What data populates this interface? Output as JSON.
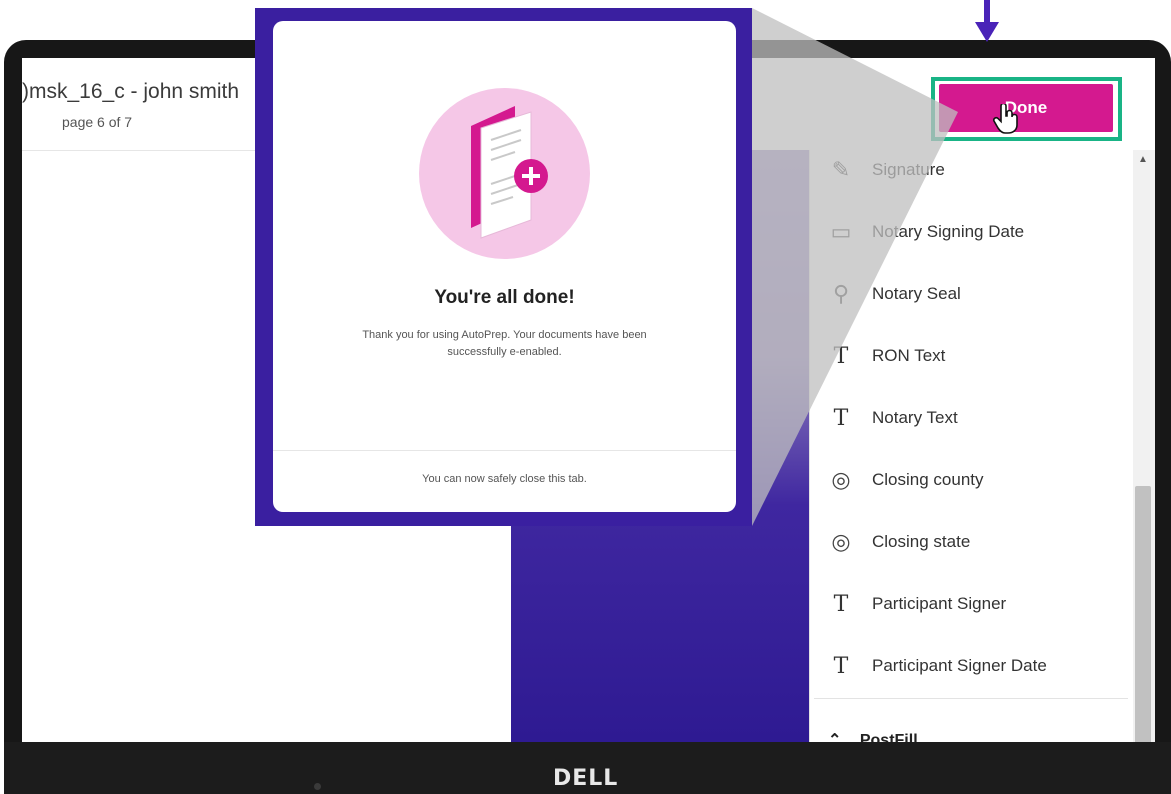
{
  "header": {
    "doc_title": ")msk_16_c - john smith",
    "page_indicator": "page 6 of 7",
    "done_label": "Done"
  },
  "sidebar": {
    "items": [
      {
        "icon": "signature-icon",
        "glyph": "✎",
        "label": "Signature"
      },
      {
        "icon": "calendar-icon",
        "glyph": "▭",
        "label": "Notary Signing Date"
      },
      {
        "icon": "stamp-icon",
        "glyph": "⚲",
        "label": "Notary Seal"
      },
      {
        "icon": "text-icon",
        "glyph": "T",
        "label": "RON Text"
      },
      {
        "icon": "text-icon",
        "glyph": "T",
        "label": "Notary Text"
      },
      {
        "icon": "location-icon",
        "glyph": "◎",
        "label": "Closing county"
      },
      {
        "icon": "location-icon",
        "glyph": "◎",
        "label": "Closing state"
      },
      {
        "icon": "text-icon",
        "glyph": "T",
        "label": "Participant Signer"
      },
      {
        "icon": "text-icon",
        "glyph": "T",
        "label": "Participant Signer Date"
      }
    ],
    "section_label": "PostFill",
    "section_glyph": "⌃"
  },
  "modal": {
    "title": "You're all done!",
    "body": "Thank you for using AutoPrep. Your documents have been successfully e-enabled.",
    "footer": "You can now safely close this tab."
  },
  "laptop": {
    "brand": "DELL"
  },
  "colors": {
    "accent": "#d4198f",
    "highlight": "#19b486",
    "popup_frame": "#3a1fa0",
    "arrow": "#4a23b8"
  }
}
